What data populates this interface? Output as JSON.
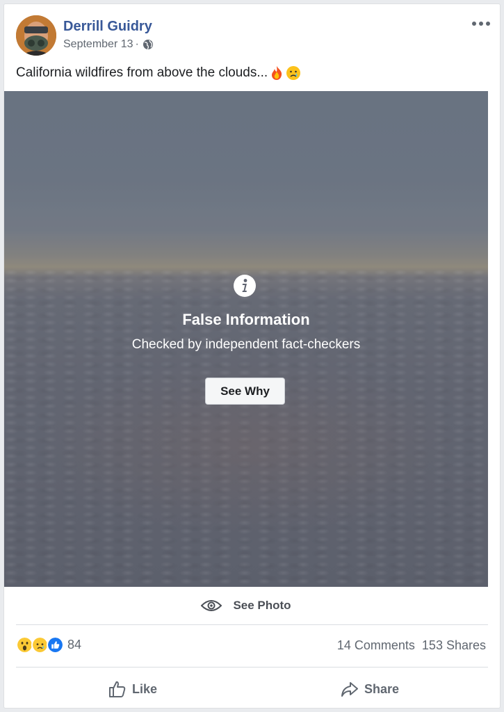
{
  "post": {
    "author": "Derrill Guidry",
    "date": "September 13",
    "separator": "·",
    "audience_icon": "globe-icon",
    "caption": "California wildfires from above the clouds...",
    "caption_emojis": [
      "fire-emoji",
      "crying-face-emoji"
    ]
  },
  "fact_check": {
    "title": "False Information",
    "subtitle": "Checked by independent fact-checkers",
    "button": "See Why",
    "icon": "info-icon"
  },
  "see_photo": {
    "label": "See Photo",
    "icon": "eye-icon"
  },
  "engagement": {
    "reaction_icons": [
      "wow-reaction-icon",
      "sad-reaction-icon",
      "like-reaction-icon"
    ],
    "reaction_count": "84",
    "comments": "14 Comments",
    "shares": "153 Shares"
  },
  "actions": {
    "like": "Like",
    "share": "Share"
  },
  "colors": {
    "author": "#385898",
    "secondary_text": "#606770",
    "like_blue": "#1877f2"
  }
}
